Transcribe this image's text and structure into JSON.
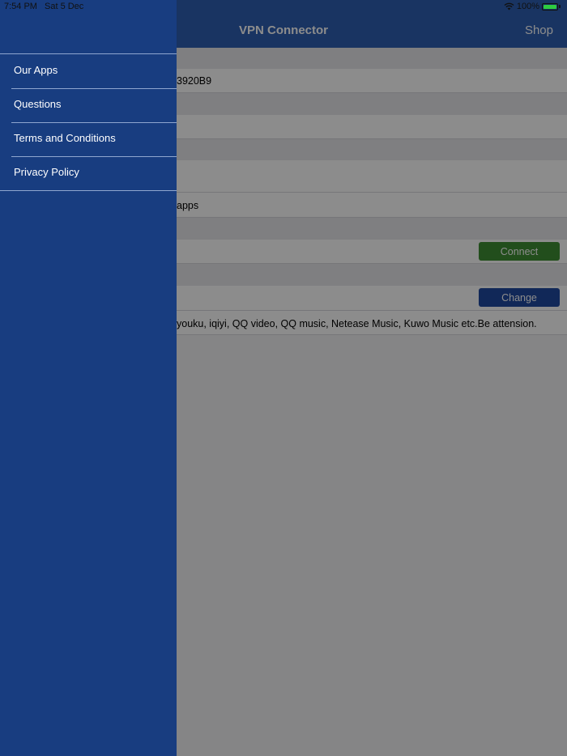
{
  "status_bar": {
    "time": "7:54 PM",
    "date": "Sat 5 Dec",
    "battery": "100%",
    "battery_level": 1.0
  },
  "navbar": {
    "title": "VPN Connector",
    "shop_label": "Shop"
  },
  "content": {
    "id_value": "3920B9",
    "apps_text": "apps",
    "connect_label": "Connect",
    "change_label": "Change",
    "note_text": "youku, iqiyi, QQ video, QQ music, Netease Music, Kuwo Music etc.Be attension."
  },
  "drawer": {
    "items": [
      {
        "label": "Our Apps"
      },
      {
        "label": "Questions"
      },
      {
        "label": "Terms and Conditions"
      },
      {
        "label": "Privacy Policy"
      }
    ]
  },
  "colors": {
    "drawer_bg": "#183d80",
    "navbar_bg": "#2f5fb3",
    "connect_green": "#3f8f33",
    "change_blue": "#1f4aa0"
  }
}
